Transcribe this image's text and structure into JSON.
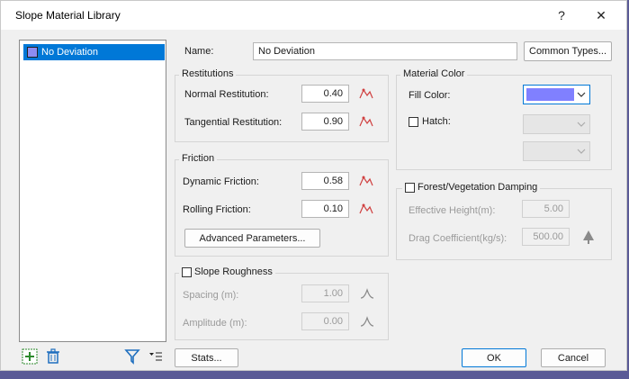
{
  "window": {
    "title": "Slope Material Library",
    "help_glyph": "?",
    "close_glyph": "✕"
  },
  "list": {
    "items": [
      {
        "label": "No Deviation",
        "color": "#8c8cf2"
      }
    ]
  },
  "name_field": {
    "label": "Name:",
    "value": "No Deviation"
  },
  "buttons": {
    "common_types": "Common Types...",
    "advanced": "Advanced Parameters...",
    "stats": "Stats...",
    "ok": "OK",
    "cancel": "Cancel"
  },
  "restitutions": {
    "title": "Restitutions",
    "normal_label": "Normal Restitution:",
    "normal_value": "0.40",
    "tangential_label": "Tangential Restitution:",
    "tangential_value": "0.90"
  },
  "friction": {
    "title": "Friction",
    "dynamic_label": "Dynamic Friction:",
    "dynamic_value": "0.58",
    "rolling_label": "Rolling Friction:",
    "rolling_value": "0.10"
  },
  "roughness": {
    "title": "Slope Roughness",
    "spacing_label": "Spacing (m):",
    "spacing_value": "1.00",
    "amplitude_label": "Amplitude (m):",
    "amplitude_value": "0.00"
  },
  "material_color": {
    "title": "Material Color",
    "fill_label": "Fill Color:",
    "fill_color": "#8080ff",
    "hatch_label": "Hatch:"
  },
  "forest": {
    "title": "Forest/Vegetation Damping",
    "height_label": "Effective Height(m):",
    "height_value": "5.00",
    "drag_label": "Drag Coefficient(kg/s):",
    "drag_value": "500.00"
  },
  "colors": {
    "accent": "#0078d7",
    "dialog_bg": "#f0f0f0",
    "icon_red": "#d04040"
  }
}
